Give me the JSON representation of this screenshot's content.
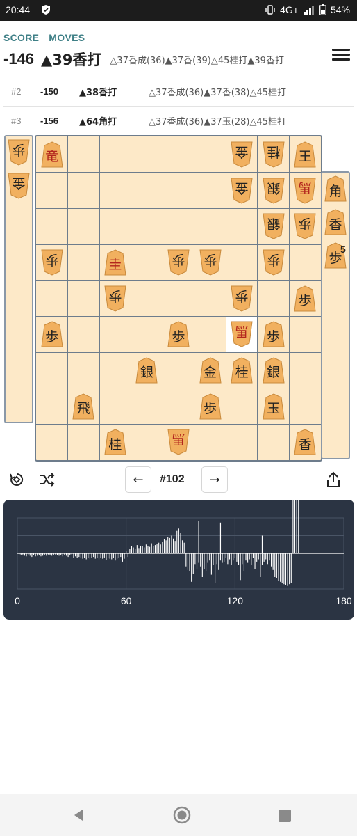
{
  "status_bar": {
    "time": "20:44",
    "network": "4G+",
    "battery": "54%",
    "icons": [
      "shield-icon",
      "vibrate-icon",
      "signal-icon",
      "battery-icon"
    ]
  },
  "header": {
    "tab_score": "SCORE",
    "tab_moves": "MOVES",
    "menu_icon": "hamburger-menu-icon"
  },
  "main_line": {
    "score": "-146",
    "move": "▲39香打",
    "pv": "△37香成(36)▲37香(39)△45桂打▲39香打"
  },
  "variations": [
    {
      "index": "#2",
      "score": "-150",
      "move": "▲38香打",
      "pv": "△37香成(36)▲37香(38)△45桂打"
    },
    {
      "index": "#3",
      "score": "-156",
      "move": "▲64角打",
      "pv": "△37香成(36)▲37玉(28)△45桂打"
    }
  ],
  "board": {
    "pieces": [
      {
        "c": "竜",
        "col": 9,
        "row": 1,
        "side": "sente",
        "promoted": true
      },
      {
        "c": "金",
        "col": 3,
        "row": 1,
        "side": "gote"
      },
      {
        "c": "桂",
        "col": 2,
        "row": 1,
        "side": "gote"
      },
      {
        "c": "王",
        "col": 1,
        "row": 1,
        "side": "sente"
      },
      {
        "c": "金",
        "col": 3,
        "row": 2,
        "side": "gote"
      },
      {
        "c": "銀",
        "col": 2,
        "row": 2,
        "side": "gote"
      },
      {
        "c": "馬",
        "col": 1,
        "row": 2,
        "side": "gote",
        "promoted": true
      },
      {
        "c": "銀",
        "col": 2,
        "row": 3,
        "side": "gote"
      },
      {
        "c": "歩",
        "col": 1,
        "row": 3,
        "side": "gote"
      },
      {
        "c": "歩",
        "col": 9,
        "row": 4,
        "side": "gote"
      },
      {
        "c": "圭",
        "col": 7,
        "row": 4,
        "side": "sente",
        "promoted": true
      },
      {
        "c": "歩",
        "col": 5,
        "row": 4,
        "side": "gote"
      },
      {
        "c": "歩",
        "col": 4,
        "row": 4,
        "side": "gote"
      },
      {
        "c": "歩",
        "col": 2,
        "row": 4,
        "side": "gote"
      },
      {
        "c": "歩",
        "col": 7,
        "row": 5,
        "side": "gote"
      },
      {
        "c": "歩",
        "col": 3,
        "row": 5,
        "side": "gote"
      },
      {
        "c": "歩",
        "col": 1,
        "row": 5,
        "side": "sente"
      },
      {
        "c": "歩",
        "col": 9,
        "row": 6,
        "side": "sente"
      },
      {
        "c": "歩",
        "col": 5,
        "row": 6,
        "side": "sente"
      },
      {
        "c": "馬",
        "col": 3,
        "row": 6,
        "side": "gote",
        "promoted": true,
        "highlight": true
      },
      {
        "c": "歩",
        "col": 2,
        "row": 6,
        "side": "sente"
      },
      {
        "c": "銀",
        "col": 6,
        "row": 7,
        "side": "sente"
      },
      {
        "c": "金",
        "col": 4,
        "row": 7,
        "side": "sente"
      },
      {
        "c": "桂",
        "col": 3,
        "row": 7,
        "side": "sente"
      },
      {
        "c": "銀",
        "col": 2,
        "row": 7,
        "side": "sente"
      },
      {
        "c": "飛",
        "col": 8,
        "row": 8,
        "side": "sente"
      },
      {
        "c": "歩",
        "col": 4,
        "row": 8,
        "side": "sente"
      },
      {
        "c": "玉",
        "col": 2,
        "row": 8,
        "side": "sente"
      },
      {
        "c": "桂",
        "col": 7,
        "row": 9,
        "side": "sente"
      },
      {
        "c": "馬",
        "col": 5,
        "row": 9,
        "side": "gote",
        "promoted": true
      },
      {
        "c": "香",
        "col": 1,
        "row": 9,
        "side": "sente"
      }
    ],
    "gote_hand": [
      {
        "c": "歩",
        "count": ""
      },
      {
        "c": "金",
        "count": ""
      }
    ],
    "sente_hand": [
      {
        "c": "角",
        "count": ""
      },
      {
        "c": "香",
        "count": ""
      },
      {
        "c": "歩",
        "count": "5"
      }
    ]
  },
  "controls": {
    "flip_icon": "rotate-board-icon",
    "shuffle_icon": "shuffle-icon",
    "prev_label": "←",
    "move_number": "#102",
    "next_label": "→",
    "share_icon": "share-icon"
  },
  "chart_data": {
    "type": "bar",
    "x_tick_labels": [
      "0",
      "60",
      "120",
      "180"
    ],
    "xlim": [
      0,
      180
    ],
    "grid": true,
    "series_color": "#ffffff",
    "background": "#2b3443",
    "x": [
      1,
      2,
      3,
      4,
      5,
      6,
      7,
      8,
      9,
      10,
      11,
      12,
      13,
      14,
      15,
      16,
      17,
      18,
      19,
      20,
      21,
      22,
      23,
      24,
      25,
      26,
      27,
      28,
      29,
      30,
      31,
      32,
      33,
      34,
      35,
      36,
      37,
      38,
      39,
      40,
      41,
      42,
      43,
      44,
      45,
      46,
      47,
      48,
      49,
      50,
      51,
      52,
      53,
      54,
      55,
      56,
      57,
      58,
      59,
      60,
      61,
      62,
      63,
      64,
      65,
      66,
      67,
      68,
      69,
      70,
      71,
      72,
      73,
      74,
      75,
      76,
      77,
      78,
      79,
      80,
      81,
      82,
      83,
      84,
      85,
      86,
      87,
      88,
      89,
      90,
      91,
      92,
      93,
      94,
      95,
      96,
      97,
      98,
      99,
      100,
      101,
      102,
      103,
      104,
      105,
      106,
      107,
      108,
      109,
      110,
      111,
      112,
      113,
      114,
      115,
      116,
      117,
      118,
      119,
      120,
      121,
      122,
      123,
      124,
      125,
      126,
      127,
      128,
      129,
      130,
      131,
      132,
      133,
      134,
      135,
      136,
      137,
      138,
      139,
      140,
      141,
      142,
      143,
      144,
      145,
      146,
      147,
      148,
      149,
      150,
      151,
      152,
      153,
      154,
      155
    ],
    "values": [
      -2,
      -3,
      -2,
      -4,
      -5,
      -3,
      -4,
      -6,
      -3,
      -5,
      -4,
      -3,
      -5,
      -4,
      -3,
      -4,
      -2,
      -3,
      -4,
      -3,
      -2,
      -3,
      -4,
      -3,
      -5,
      -3,
      -4,
      -6,
      -3,
      -2,
      -7,
      -5,
      -8,
      -6,
      -7,
      -9,
      -8,
      -10,
      -7,
      -9,
      -8,
      -6,
      -9,
      -7,
      -10,
      -8,
      -9,
      -7,
      -11,
      -8,
      -9,
      -10,
      -8,
      -12,
      -9,
      -7,
      -6,
      -14,
      -9,
      4,
      -6,
      8,
      12,
      10,
      7,
      14,
      9,
      13,
      12,
      10,
      15,
      12,
      11,
      17,
      13,
      14,
      16,
      18,
      15,
      20,
      24,
      22,
      28,
      26,
      30,
      25,
      21,
      38,
      42,
      35,
      22,
      18,
      -22,
      -28,
      -30,
      -48,
      -35,
      -18,
      -26,
      -16,
      -22,
      -40,
      -26,
      -30,
      -16,
      -12,
      -36,
      -20,
      -50,
      -18,
      -28,
      -12,
      -16,
      -14,
      -8,
      -18,
      -10,
      -20,
      -12,
      -8,
      -14,
      -20,
      -45,
      -18,
      -30,
      -12,
      -16,
      -10,
      -20,
      -8,
      -26,
      -14,
      -10,
      -40,
      -20,
      -14,
      -10,
      -18,
      -12,
      -22,
      -28,
      -40,
      -42,
      -46,
      -48,
      -50,
      -52,
      -54,
      -55,
      -52,
      -50
    ],
    "spikes_up": [
      [
        100,
        55
      ],
      [
        112,
        52
      ],
      [
        135,
        30
      ]
    ],
    "ylim": [
      -60,
      60
    ]
  }
}
